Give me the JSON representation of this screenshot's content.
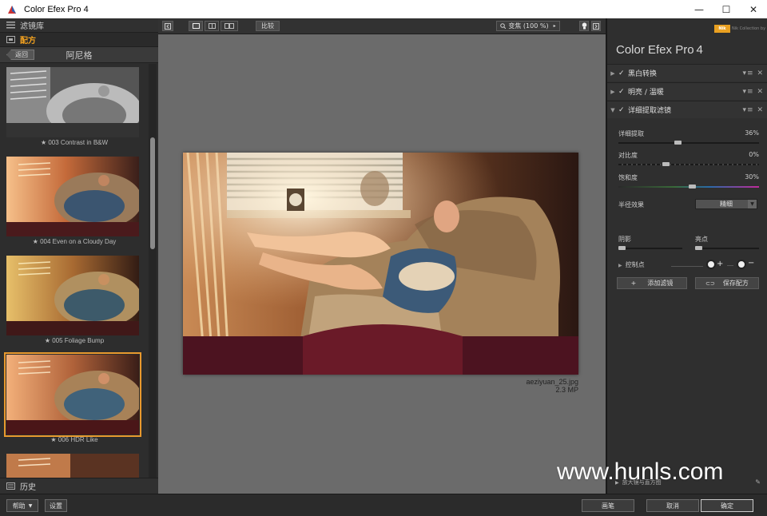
{
  "window": {
    "title": "Color Efex Pro 4",
    "minimize": "—",
    "maximize": "☐",
    "close": "✕"
  },
  "left": {
    "library_label": "滤镜库",
    "recipes_label": "配方",
    "back_label": "返回",
    "category_title": "阿尼格",
    "history_label": "历史",
    "thumbs": [
      {
        "label": "★ 003 Contrast in B&W"
      },
      {
        "label": "★ 004 Even on a Cloudy Day"
      },
      {
        "label": "★ 005 Foliage Bump"
      },
      {
        "label": "★ 006 HDR Like"
      }
    ]
  },
  "toolbar": {
    "compare_label": "比较",
    "zoom_label": "变焦 (100 %)"
  },
  "image": {
    "filename": "aeziyuan_25.jpg",
    "size": "2.3 MP"
  },
  "right": {
    "brand": "Nik Collection by DxO",
    "app_name": "Color Efex Pro",
    "app_version": "4",
    "filters": [
      {
        "name": "黑白转换"
      },
      {
        "name": "明亮 / 温暖"
      },
      {
        "name": "详细提取滤镜"
      }
    ],
    "params": {
      "detail_label": "详细提取",
      "detail_value": "36%",
      "contrast_label": "对比度",
      "contrast_value": "0%",
      "saturation_label": "饱和度",
      "saturation_value": "30%",
      "radius_label": "半径效果",
      "radius_option": "精细",
      "shadows_label": "阴影",
      "highlights_label": "亮点",
      "controlpoints_label": "控制点"
    },
    "add_filter_label": "添加滤镜",
    "save_recipe_label": "保存配方",
    "loupe_label": "放大镜与直方图"
  },
  "bottom": {
    "help_label": "帮助",
    "settings_label": "设置",
    "brush_label": "画笔",
    "cancel_label": "取消",
    "ok_label": "确定"
  },
  "watermark": "www.hunls.com",
  "colors": {
    "accent": "#e9992d",
    "panel": "#2f2f2f",
    "canvas": "#6b6b6b"
  }
}
